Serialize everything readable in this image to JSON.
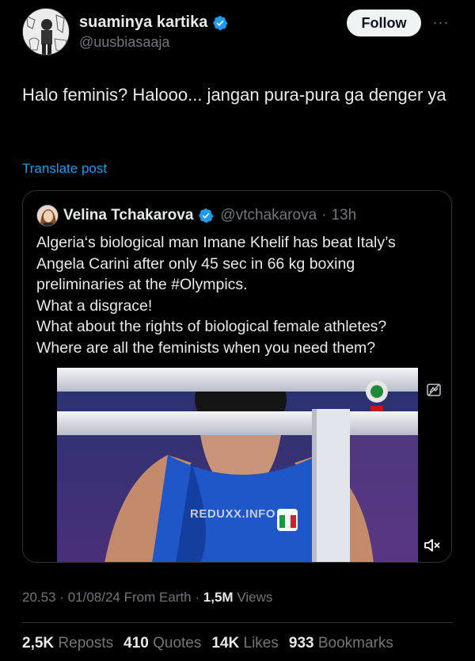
{
  "author": {
    "display_name": "suaminya kartika",
    "handle": "@uusbiasaaja"
  },
  "follow_label": "Follow",
  "more_label": "···",
  "post": {
    "text": "Halo feminis? Halooo... jangan pura-pura ga denger ya",
    "translate_label": "Translate post"
  },
  "quote": {
    "display_name": "Velina Tchakarova",
    "handle": "@vtchakarova",
    "separator": "·",
    "time": "13h",
    "lines": [
      "Algeria‘s biological man Imane Khelif has beat Italy’s",
      "Angela Carini after only 45 sec in 66 kg boxing",
      "preliminaries at the #Olympics.",
      "What a disgrace!",
      "What about the rights of biological female athletes?",
      "Where are all the feminists when you need them?"
    ],
    "media": {
      "watermark": "REDUXX.INFO"
    }
  },
  "meta": {
    "time": "20.53",
    "sep1": "·",
    "date": "01/08/24",
    "source": "From Earth",
    "sep2": "·",
    "views_count": "1,5M",
    "views_label": "Views"
  },
  "stats": {
    "reposts_count": "2,5K",
    "reposts_label": "Reposts",
    "quotes_count": "410",
    "quotes_label": "Quotes",
    "likes_count": "14K",
    "likes_label": "Likes",
    "bookmarks_count": "933",
    "bookmarks_label": "Bookmarks"
  },
  "colors": {
    "background": "#000000",
    "text": "#e7e9ea",
    "secondary": "#71767b",
    "accent": "#1d9bf0",
    "border": "#2f3336"
  },
  "icons": {
    "verified": "verified-badge-icon",
    "more": "more-horizontal-icon",
    "mute": "volume-muted-icon",
    "ai_label": "content-label-icon"
  }
}
